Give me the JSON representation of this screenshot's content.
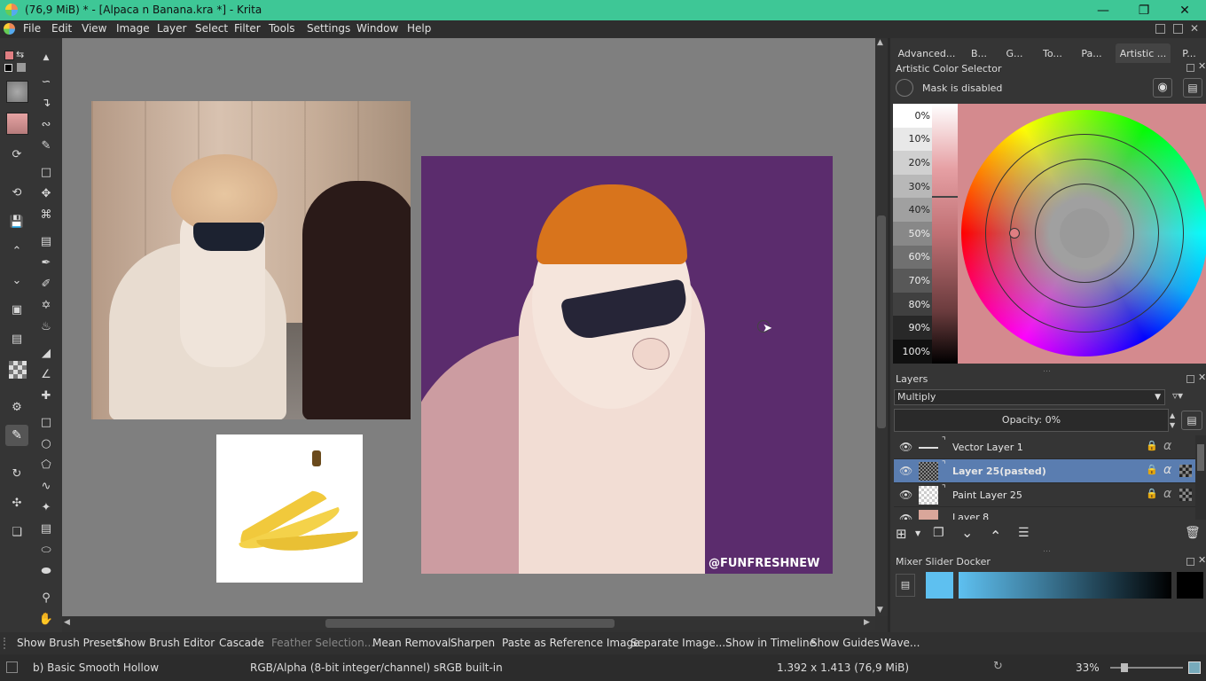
{
  "window": {
    "title": "(76,9 MiB)  * - [Alpaca n Banana.kra *] - Krita"
  },
  "menubar": [
    "File",
    "Edit",
    "View",
    "Image",
    "Layer",
    "Select",
    "Filter",
    "Tools",
    "Settings",
    "Window",
    "Help"
  ],
  "docker_tabs": [
    "Advanced...",
    "B...",
    "G...",
    "To...",
    "Pa...",
    "Artistic ...",
    "P..."
  ],
  "color_selector": {
    "title": "Artistic Color Selector",
    "mask_status": "Mask is disabled",
    "percentages": [
      "0%",
      "10%",
      "20%",
      "30%",
      "40%",
      "50%",
      "60%",
      "70%",
      "80%",
      "90%",
      "100%"
    ]
  },
  "layers": {
    "title": "Layers",
    "blend_mode": "Multiply",
    "opacity_label": "Opacity:  0%",
    "items": [
      {
        "name": "Vector Layer 1",
        "selected": false
      },
      {
        "name": "Layer 25(pasted)",
        "selected": true
      },
      {
        "name": "Paint Layer 25",
        "selected": false
      },
      {
        "name": "Layer 8",
        "selected": false
      }
    ]
  },
  "mixer": {
    "title": "Mixer Slider Docker"
  },
  "canvas": {
    "watermark": "@FUNFRESHNEW"
  },
  "actionbar": [
    "Show Brush Presets",
    "Show Brush Editor",
    "Cascade",
    "Feather Selection...",
    "Mean Removal",
    "Sharpen",
    "Paste as Reference Image",
    "Separate Image...",
    "Show in Timeline",
    "Show Guides",
    "Wave..."
  ],
  "statusbar": {
    "brush": "b) Basic Smooth Hollow",
    "color_profile": "RGB/Alpha (8-bit integer/channel)  sRGB built-in",
    "doc_size": "1.392 x 1.413 (76,9 MiB)",
    "zoom": "33%"
  },
  "colors": {
    "title_bg": "#3ec796",
    "fg_color": "#e07e82",
    "mixer_color": "#5ec0f0",
    "selected_layer": "#5a7db0",
    "purple_bg": "#5b2c6d"
  }
}
